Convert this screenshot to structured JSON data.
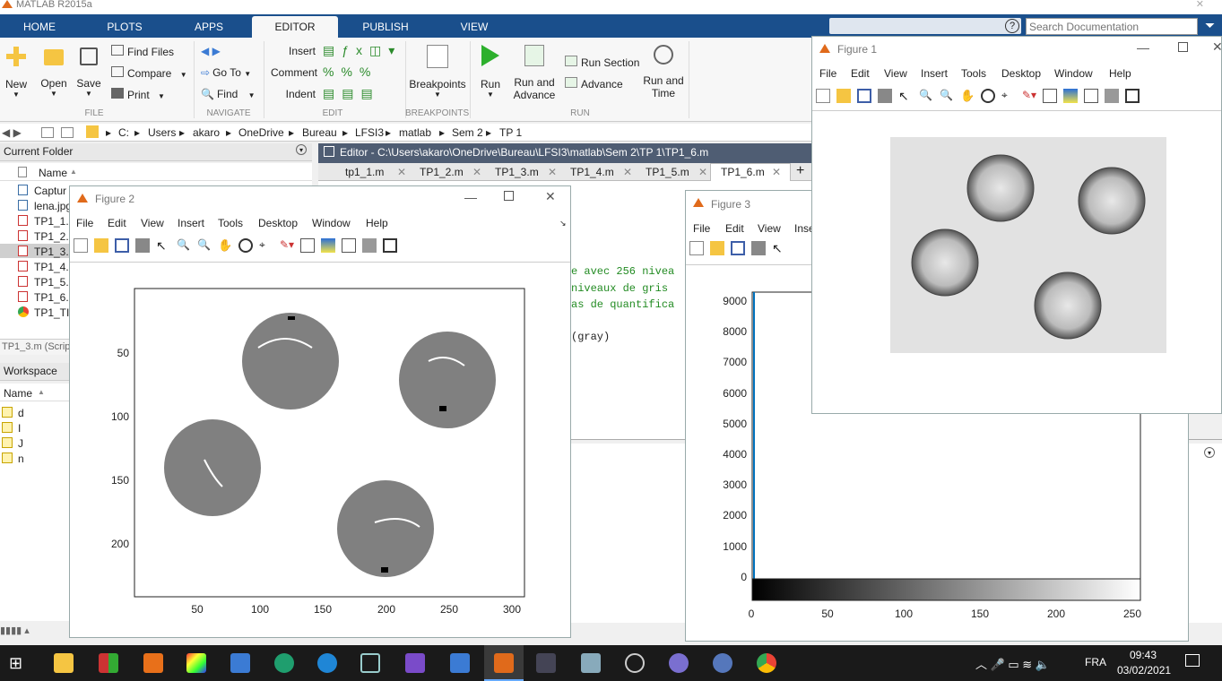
{
  "app": {
    "title": "MATLAB R2015a"
  },
  "main_tabs": [
    "HOME",
    "PLOTS",
    "APPS",
    "EDITOR",
    "PUBLISH",
    "VIEW"
  ],
  "ribbon": {
    "file": {
      "new": "New",
      "open": "Open",
      "save": "Save",
      "find_files": "Find Files",
      "compare": "Compare",
      "print": "Print",
      "section": "FILE"
    },
    "navigate": {
      "go_to": "Go To",
      "find": "Find",
      "section": "NAVIGATE"
    },
    "edit": {
      "insert": "Insert",
      "comment": "Comment",
      "indent": "Indent",
      "section": "EDIT"
    },
    "breakpoints": {
      "label": "Breakpoints",
      "section": "BREAKPOINTS"
    },
    "run": {
      "run": "Run",
      "run_and_advance": "Run and Advance",
      "run_section": "Run Section",
      "advance": "Advance",
      "run_and_time": "Run and Time",
      "section": "RUN"
    }
  },
  "search": {
    "placeholder": "Search Documentation"
  },
  "breadcrumb": [
    "C:",
    "Users",
    "akaro",
    "OneDrive",
    "Bureau",
    "LFSI3",
    "matlab",
    "Sem 2",
    "TP 1"
  ],
  "current_folder": {
    "title": "Current Folder",
    "col_name": "Name",
    "files": [
      "Captur",
      "lena.jpg",
      "TP1_1.n",
      "TP1_2.n",
      "TP1_3.n",
      "TP1_4.n",
      "TP1_5.n",
      "TP1_6.n",
      "TP1_TI.p"
    ],
    "details": "TP1_3.m (Scrip"
  },
  "workspace": {
    "title": "Workspace",
    "col_name": "Name",
    "vars": [
      "d",
      "I",
      "J",
      "n"
    ]
  },
  "editor": {
    "title": "Editor - C:\\Users\\akaro\\OneDrive\\Bureau\\LFSI3\\matlab\\Sem 2\\TP 1\\TP1_6.m",
    "tabs": [
      "tp1_1.m",
      "TP1_2.m",
      "TP1_3.m",
      "TP1_4.m",
      "TP1_5.m",
      "TP1_6.m"
    ],
    "code": [
      "e avec 256 nivea",
      "niveaux de gris",
      "as de quantifica",
      "(gray)"
    ]
  },
  "figure_menu": [
    "File",
    "Edit",
    "View",
    "Insert",
    "Tools",
    "Desktop",
    "Window",
    "Help"
  ],
  "figure2": {
    "title": "Figure 2",
    "yticks": [
      "50",
      "100",
      "150",
      "200"
    ],
    "xticks": [
      "50",
      "100",
      "150",
      "200",
      "250",
      "300"
    ]
  },
  "figure3": {
    "title": "Figure 3",
    "menu_partial": [
      "File",
      "Edit",
      "View",
      "Inse"
    ],
    "yticks": [
      "9000",
      "8000",
      "7000",
      "6000",
      "5000",
      "4000",
      "3000",
      "2000",
      "1000",
      "0"
    ],
    "xticks": [
      "0",
      "50",
      "100",
      "150",
      "200",
      "250"
    ]
  },
  "figure1": {
    "title": "Figure 1"
  },
  "taskbar": {
    "lang": "FRA",
    "time": "09:43",
    "date": "03/02/2021"
  },
  "colors": {
    "tab_bar": "#1a4f8c",
    "accent": "#0072bd",
    "run_green": "#2db02d"
  }
}
